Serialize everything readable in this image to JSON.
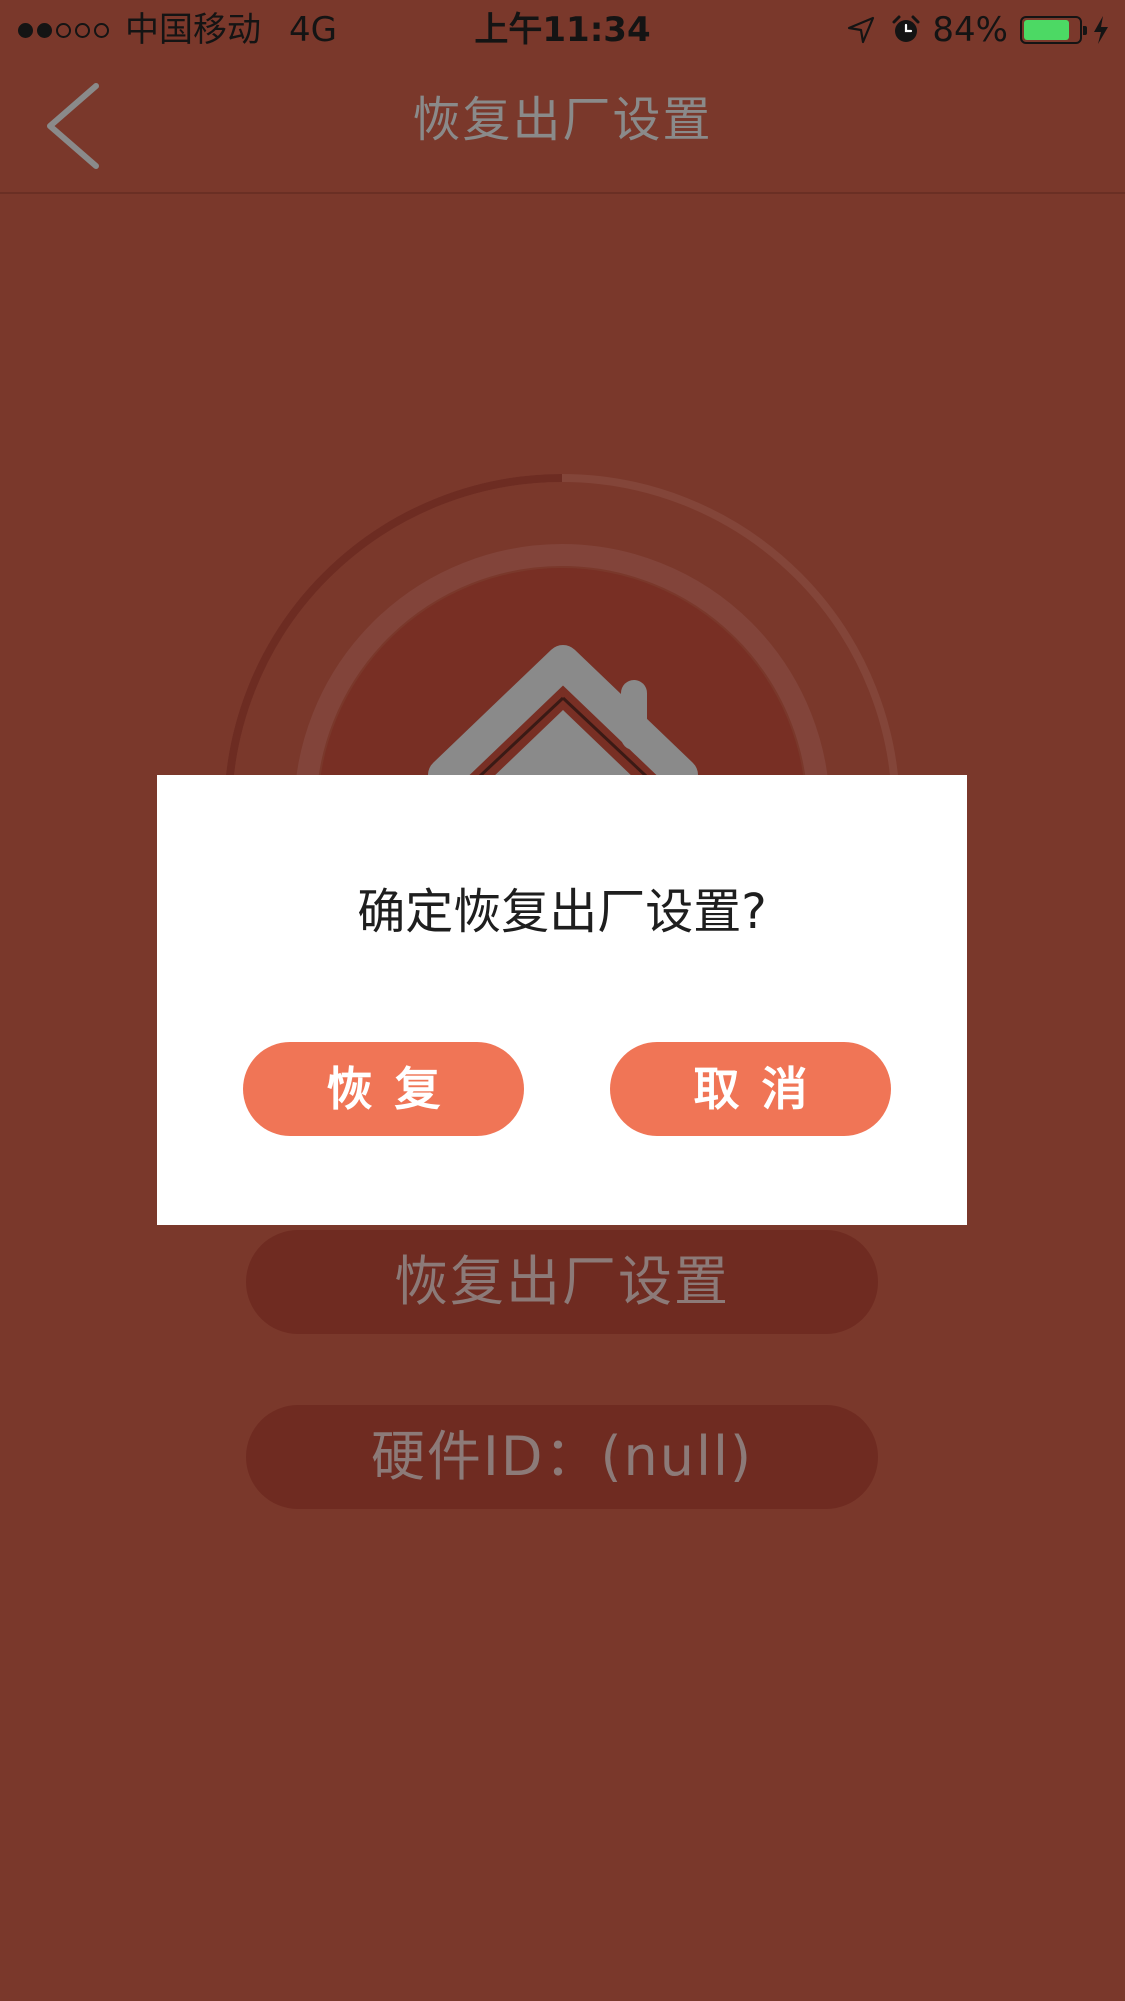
{
  "status_bar": {
    "carrier": "中国移动",
    "network": "4G",
    "time": "上午11:34",
    "battery_percent": "84%",
    "battery_level": 0.84,
    "icons": [
      "signal-dots-icon",
      "location-arrow-icon",
      "alarm-clock-icon",
      "battery-icon",
      "charging-bolt-icon"
    ]
  },
  "nav": {
    "title": "恢复出厂设置",
    "back_icon": "chevron-left-icon"
  },
  "main": {
    "progress_icon": "progress-ring-icon",
    "home_icon": "house-icon",
    "reset_button_label": "恢复出厂设置",
    "hardware_id_label": "硬件ID：(null)"
  },
  "dialog": {
    "message": "确定恢复出厂设置?",
    "confirm_label": "恢复",
    "cancel_label": "取消"
  },
  "colors": {
    "background_dimmed": "#7a382b",
    "accent": "#f07556",
    "dialog_bg": "#ffffff",
    "battery_green": "#4cd964"
  }
}
